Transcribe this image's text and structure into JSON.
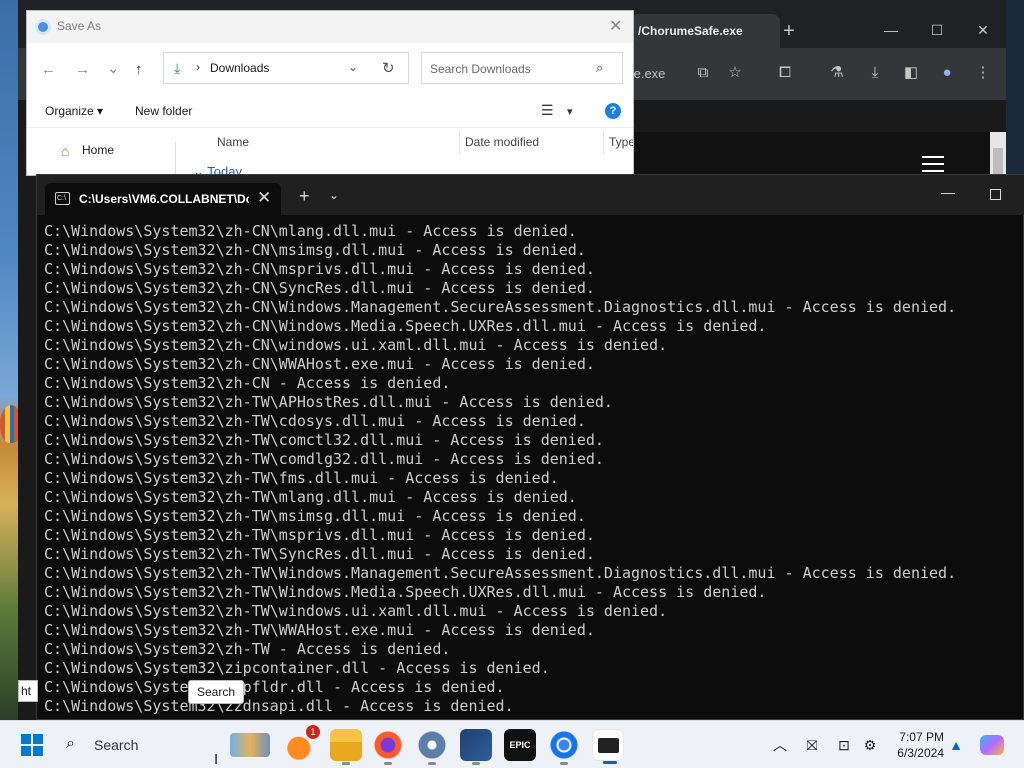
{
  "chrome": {
    "tab_title": "/ChorumeSafe.exe",
    "new_tab": "+",
    "minimize": "—",
    "maximize": "☐",
    "close": "✕",
    "url_fragment": "fe.exe"
  },
  "save_as": {
    "title": "Save As",
    "close": "✕",
    "back": "←",
    "forward": "→",
    "recent": "⌄",
    "up": "↑",
    "path_separator": "›",
    "path": "Downloads",
    "path_dropdown": "⌄",
    "refresh": "↻",
    "search_placeholder": "Search Downloads",
    "organize": "Organize ▾",
    "new_folder": "New folder",
    "view_icon": "☰",
    "view_chevron": "▾",
    "help": "?",
    "home": "Home",
    "columns": {
      "name": "Name",
      "date_modified": "Date modified",
      "type": "Type"
    },
    "group": "⌄ Today"
  },
  "terminal": {
    "tab_title": "C:\\Users\\VM6.COLLABNET\\Dc",
    "tab_icon_text": "C:\\",
    "close_tab": "✕",
    "new_tab": "+",
    "dropdown": "⌄",
    "minimize": "—",
    "lines": [
      "C:\\Windows\\System32\\zh-CN\\mlang.dll.mui - Access is denied.",
      "C:\\Windows\\System32\\zh-CN\\msimsg.dll.mui - Access is denied.",
      "C:\\Windows\\System32\\zh-CN\\msprivs.dll.mui - Access is denied.",
      "C:\\Windows\\System32\\zh-CN\\SyncRes.dll.mui - Access is denied.",
      "C:\\Windows\\System32\\zh-CN\\Windows.Management.SecureAssessment.Diagnostics.dll.mui - Access is denied.",
      "C:\\Windows\\System32\\zh-CN\\Windows.Media.Speech.UXRes.dll.mui - Access is denied.",
      "C:\\Windows\\System32\\zh-CN\\windows.ui.xaml.dll.mui - Access is denied.",
      "C:\\Windows\\System32\\zh-CN\\WWAHost.exe.mui - Access is denied.",
      "C:\\Windows\\System32\\zh-CN - Access is denied.",
      "C:\\Windows\\System32\\zh-TW\\APHostRes.dll.mui - Access is denied.",
      "C:\\Windows\\System32\\zh-TW\\cdosys.dll.mui - Access is denied.",
      "C:\\Windows\\System32\\zh-TW\\comctl32.dll.mui - Access is denied.",
      "C:\\Windows\\System32\\zh-TW\\comdlg32.dll.mui - Access is denied.",
      "C:\\Windows\\System32\\zh-TW\\fms.dll.mui - Access is denied.",
      "C:\\Windows\\System32\\zh-TW\\mlang.dll.mui - Access is denied.",
      "C:\\Windows\\System32\\zh-TW\\msimsg.dll.mui - Access is denied.",
      "C:\\Windows\\System32\\zh-TW\\msprivs.dll.mui - Access is denied.",
      "C:\\Windows\\System32\\zh-TW\\SyncRes.dll.mui - Access is denied.",
      "C:\\Windows\\System32\\zh-TW\\Windows.Management.SecureAssessment.Diagnostics.dll.mui - Access is denied.",
      "C:\\Windows\\System32\\zh-TW\\Windows.Media.Speech.UXRes.dll.mui - Access is denied.",
      "C:\\Windows\\System32\\zh-TW\\windows.ui.xaml.dll.mui - Access is denied.",
      "C:\\Windows\\System32\\zh-TW\\WWAHost.exe.mui - Access is denied.",
      "C:\\Windows\\System32\\zh-TW - Access is denied.",
      "C:\\Windows\\System32\\zipcontainer.dll - Access is denied.",
      "C:\\Windows\\System32\\zipfldr.dll - Access is denied.",
      "C:\\Windows\\System32\\zzdnsapi.dll - Access is denied."
    ]
  },
  "tooltip": {
    "text": "Search"
  },
  "status_snippet": "ht",
  "taskbar": {
    "search_icon": "⌕",
    "search_label": "Search",
    "firefox_badge": "1",
    "epic_label": "EPIC",
    "tray": {
      "chevron": "︿",
      "network": "⛝",
      "vpn": "⊡",
      "settings": "⚙",
      "bell": "🔔"
    },
    "time": "7:07 PM",
    "date": "6/3/2024"
  },
  "colors": {
    "terminal_bg": "#0c0c0c",
    "terminal_text": "#cccccc",
    "accent": "#0078d4",
    "chrome_dark": "#202124"
  }
}
